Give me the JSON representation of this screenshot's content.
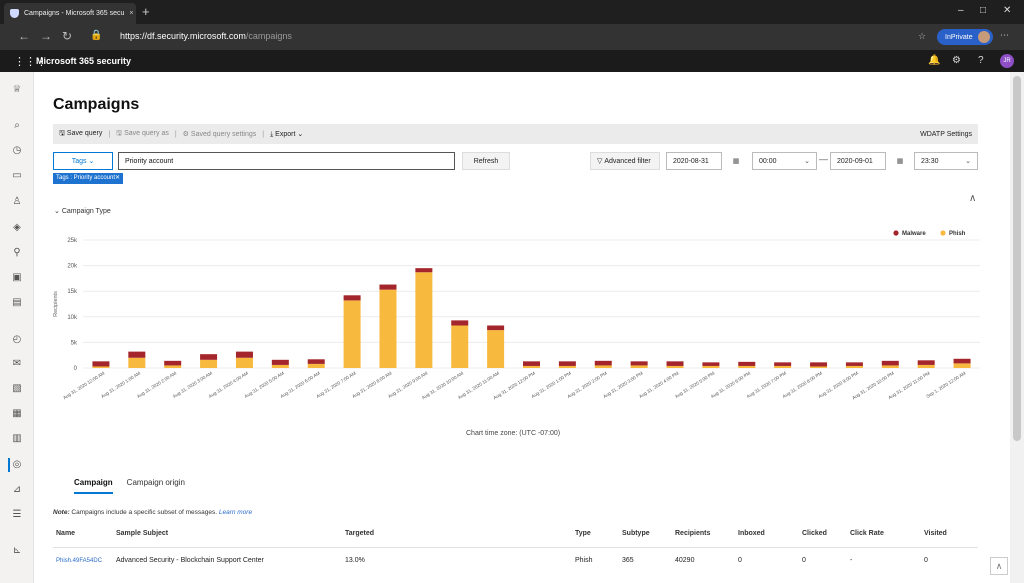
{
  "browser": {
    "tab_title": "Campaigns - Microsoft 365 secu",
    "tab_close": "×",
    "new_tab": "+",
    "url_host": "https://df.security.microsoft.com",
    "url_path": "/campaigns",
    "private_label": "InPrivate",
    "window_controls": [
      "–",
      "□",
      "✕"
    ]
  },
  "app": {
    "name": "Microsoft 365 security",
    "avatar_initials": "JR"
  },
  "page": {
    "title": "Campaigns"
  },
  "toolbar": {
    "save_query": "Save query",
    "save_query_as": "Save query as",
    "saved_query_settings": "Saved query settings",
    "export": "Export",
    "wdatp_settings": "WDATP Settings"
  },
  "filters": {
    "tags_label": "Tags",
    "search_value": "Priority account",
    "refresh": "Refresh",
    "chip": "Tags : Priority account",
    "advanced_filter": "Advanced filter",
    "start_date": "2020-08-31",
    "start_time": "00:00",
    "end_date": "2020-09-01",
    "end_time": "23:30"
  },
  "section": {
    "campaign_type": "Campaign Type",
    "time_zone": "Chart time zone: (UTC -07:00)"
  },
  "chart_data": {
    "type": "bar",
    "stacked": true,
    "ylabel": "Recipients",
    "ylim": [
      0,
      25000
    ],
    "yticks": [
      "0",
      "5k",
      "10k",
      "15k",
      "20k",
      "25k"
    ],
    "legend": {
      "position": "top-right"
    },
    "categories": [
      "Aug 31, 2020 12:00 AM",
      "Aug 31, 2020 1:00 AM",
      "Aug 31, 2020 2:00 AM",
      "Aug 31, 2020 3:00 AM",
      "Aug 31, 2020 4:00 AM",
      "Aug 31, 2020 5:00 AM",
      "Aug 31, 2020 6:00 AM",
      "Aug 31, 2020 7:00 AM",
      "Aug 31, 2020 8:00 AM",
      "Aug 31, 2020 9:00 AM",
      "Aug 31, 2020 10:00 AM",
      "Aug 31, 2020 11:00 AM",
      "Aug 31, 2020 12:00 PM",
      "Aug 31, 2020 1:00 PM",
      "Aug 31, 2020 2:00 PM",
      "Aug 31, 2020 3:00 PM",
      "Aug 31, 2020 4:00 PM",
      "Aug 31, 2020 5:00 PM",
      "Aug 31, 2020 6:00 PM",
      "Aug 31, 2020 7:00 PM",
      "Aug 31, 2020 8:00 PM",
      "Aug 31, 2020 9:00 PM",
      "Aug 31, 2020 10:00 PM",
      "Aug 31, 2020 11:00 PM",
      "Sep 1, 2020 12:00 AM"
    ],
    "series": [
      {
        "name": "Phish",
        "color": "#f7b93e",
        "values": [
          300,
          2000,
          500,
          1600,
          2000,
          600,
          800,
          13200,
          15300,
          18700,
          8300,
          7400,
          400,
          400,
          500,
          500,
          400,
          400,
          400,
          400,
          300,
          400,
          500,
          600,
          900
        ]
      },
      {
        "name": "Malware",
        "color": "#a4262c",
        "values": [
          1000,
          1200,
          900,
          1100,
          1200,
          1000,
          900,
          1000,
          1000,
          800,
          1000,
          900,
          900,
          900,
          900,
          800,
          900,
          700,
          800,
          700,
          800,
          700,
          900,
          900,
          900
        ]
      }
    ]
  },
  "tabs": {
    "campaign": "Campaign",
    "campaign_origin": "Campaign origin"
  },
  "note": {
    "prefix": "Note:",
    "text": "Campaigns include a specific subset of messages.",
    "link": "Learn more"
  },
  "table": {
    "headers": {
      "name": "Name",
      "sample_subject": "Sample Subject",
      "targeted": "Targeted",
      "type": "Type",
      "subtype": "Subtype",
      "recipients": "Recipients",
      "inboxed": "Inboxed",
      "clicked": "Clicked",
      "click_rate": "Click Rate",
      "visited": "Visited"
    },
    "rows": [
      {
        "name": "Phish.49FA54DC",
        "sample_subject": "Advanced Security - Blockchain Support Center",
        "targeted": "13.0%",
        "type": "Phish",
        "subtype": "365",
        "recipients": "40290",
        "inboxed": "0",
        "clicked": "0",
        "click_rate": "-",
        "visited": "0"
      }
    ]
  }
}
